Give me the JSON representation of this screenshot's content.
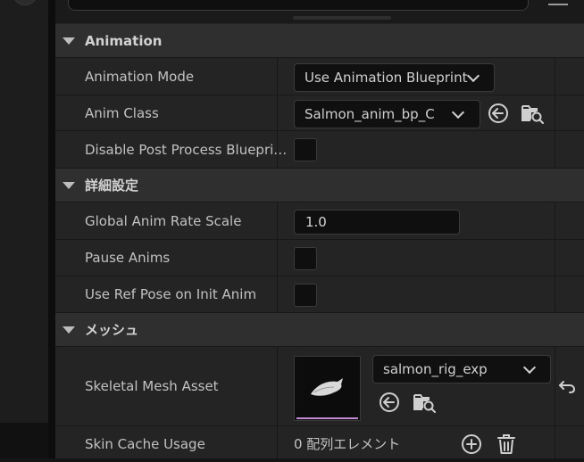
{
  "sections": {
    "animation": {
      "title": "Animation"
    },
    "details": {
      "title": "詳細設定"
    },
    "mesh": {
      "title": "メッシュ"
    }
  },
  "animation_rows": {
    "mode_label": "Animation Mode",
    "mode_value": "Use Animation Blueprint",
    "class_label": "Anim Class",
    "class_value": "Salmon_anim_bp_C",
    "disable_pp_label": "Disable Post Process Bluepri…"
  },
  "details_rows": {
    "rate_label": "Global Anim Rate Scale",
    "rate_value": "1.0",
    "pause_label": "Pause Anims",
    "refpose_label": "Use Ref Pose on Init Anim"
  },
  "mesh_rows": {
    "asset_label": "Skeletal Mesh Asset",
    "asset_value": "salmon_rig_exp",
    "skin_label": "Skin Cache Usage",
    "skin_value": "0 配列エレメント"
  },
  "colors": {
    "panel_bg": "#242424",
    "header_bg": "#2f2f2f",
    "field_bg": "#101010",
    "thumbnail_underline": "#c58ad6"
  },
  "icons": [
    "search-icon",
    "chevron-down-icon",
    "browse-back-arrow-icon",
    "folder-search-icon",
    "reset-arrow-icon",
    "add-element-icon",
    "trash-icon"
  ]
}
